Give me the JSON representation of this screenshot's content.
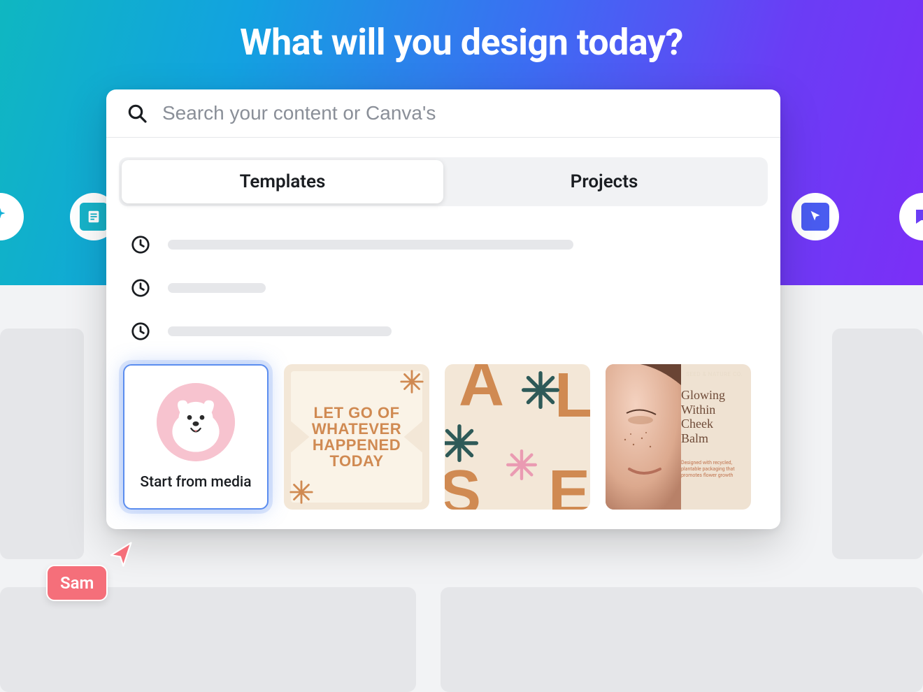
{
  "hero": {
    "title": "What will you design today?"
  },
  "search": {
    "placeholder": "Search your content or Canva's",
    "value": ""
  },
  "tabs": [
    {
      "label": "Templates",
      "active": true
    },
    {
      "label": "Projects",
      "active": false
    }
  ],
  "start_card": {
    "label": "Start from media"
  },
  "templates": {
    "quote": {
      "line1": "LET GO OF",
      "line2": "WHATEVER",
      "line3": "HAPPENED",
      "line4": "TODAY"
    },
    "letters": {
      "a": "A",
      "l": "L",
      "s": "S",
      "e": "E"
    },
    "balm": {
      "brand": "SEED & NATURE CO.",
      "title1": "Glowing",
      "title2": "Within",
      "title3": "Cheek",
      "title4": "Balm",
      "desc": "Designed with recycled, plantable packaging that promotes flower growth"
    }
  },
  "cursor": {
    "user_name": "Sam",
    "color": "#f56f7a"
  }
}
